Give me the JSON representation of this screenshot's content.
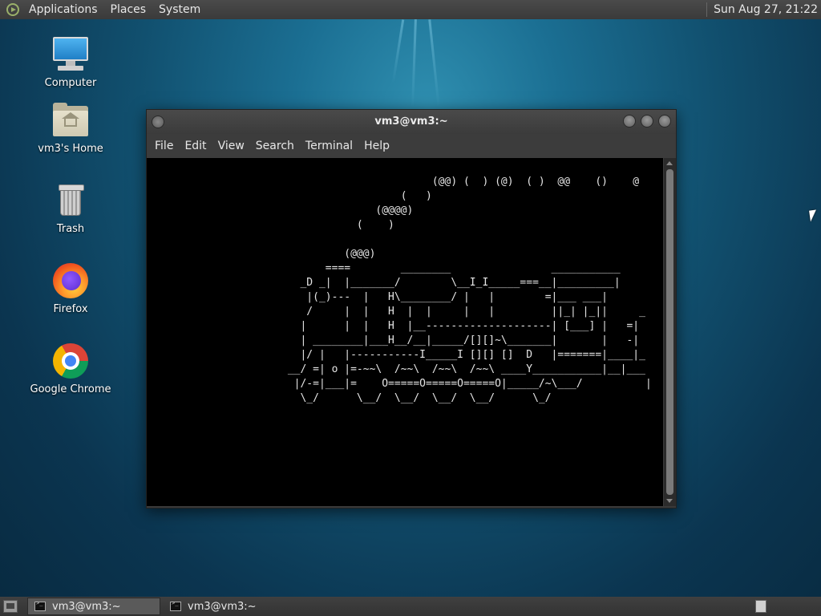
{
  "top_panel": {
    "menus": [
      "Applications",
      "Places",
      "System"
    ],
    "clock": "Sun Aug 27, 21:22"
  },
  "desktop_icons": [
    {
      "label": "Computer",
      "icon": "computer-icon"
    },
    {
      "label": "vm3's Home",
      "icon": "home-folder-icon"
    },
    {
      "label": "Trash",
      "icon": "trash-icon"
    },
    {
      "label": "Firefox",
      "icon": "firefox-icon"
    },
    {
      "label": "Google Chrome",
      "icon": "chrome-icon"
    }
  ],
  "terminal": {
    "title": "vm3@vm3:~",
    "menu": [
      "File",
      "Edit",
      "View",
      "Search",
      "Terminal",
      "Help"
    ],
    "output": "                        (@@) (  ) (@)  ( )  @@    ()    @\n                   (   )\n               (@@@@)\n            (    )\n\n          (@@@)\n       ====        ________                ___________\n   _D _|  |_______/        \\__I_I_____===__|_________|\n    |(_)---  |   H\\________/ |   |        =|___ ___|\n    /     |  |   H  |  |     |   |         ||_| |_||     _\n   |      |  |   H  |__--------------------| [___] |   =|\n   | ________|___H__/__|_____/[][]~\\_______|       |   -|\n   |/ |   |-----------I_____I [][] []  D   |=======|____|_\n __/ =| o |=-~~\\  /~~\\  /~~\\  /~~\\ ____Y___________|__|___\n  |/-=|___|=    O=====O=====O=====O|_____/~\\___/          |\n   \\_/      \\__/  \\__/  \\__/  \\__/      \\_/"
  },
  "taskbar": {
    "tasks": [
      {
        "label": "vm3@vm3:~",
        "active": true
      },
      {
        "label": "vm3@vm3:~",
        "active": false
      }
    ]
  },
  "colors": {
    "panel": "#3a3a3a",
    "terminal_bg": "#000000",
    "terminal_fg": "#e6e6e6",
    "desktop": "#11506f"
  }
}
